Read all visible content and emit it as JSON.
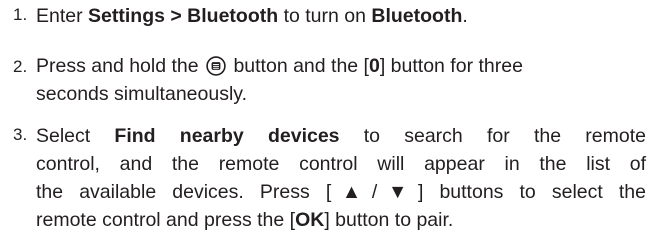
{
  "steps": [
    {
      "number": "1.",
      "parts": {
        "a": "Enter ",
        "b": "Settings > Bluetooth",
        "c": " to turn on ",
        "d": "Bluetooth",
        "e": "."
      }
    },
    {
      "number": "2.",
      "parts": {
        "a": "Press and hold the ",
        "icon": "menu-icon",
        "b": " button and the [",
        "c": "0",
        "d": "] button for three",
        "e": "seconds simultaneously."
      }
    },
    {
      "number": "3.",
      "parts": {
        "l1a": "Select ",
        "l1b": "Find nearby devices",
        "l1c": " to search for the remote",
        "l2": "control, and the remote control will appear in the list of",
        "l3": "the available devices. Press [▲/▼] buttons to select the",
        "l4a": "remote control and press the [",
        "l4b": "OK",
        "l4c": "] button to pair."
      }
    }
  ]
}
